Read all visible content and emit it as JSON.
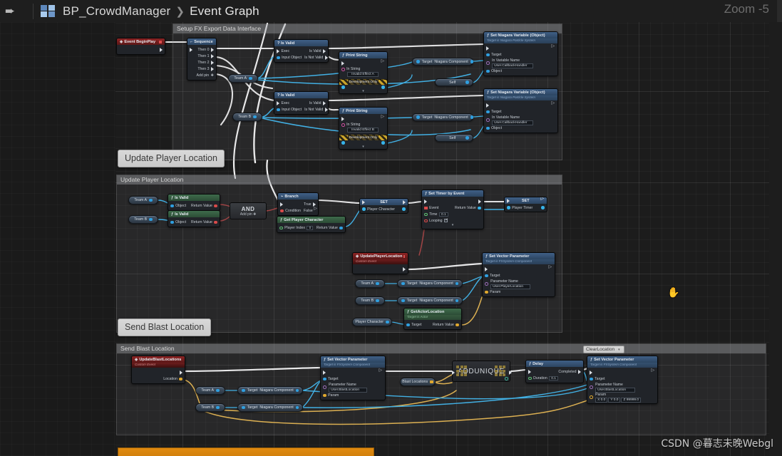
{
  "topbar": {
    "forward_icon": "forward-arrow-icon",
    "blueprint_icon": "blueprint-grid-icon",
    "blueprint_name": "BP_CrowdManager",
    "separator": "❯",
    "graph_name": "Event Graph",
    "zoom_label": "Zoom -5"
  },
  "tooltips": {
    "graph_title_overlay": "Setup FX Export Data Interface",
    "update_player_location": "Update Player Location",
    "send_blast_location": "Send Blast Location"
  },
  "watermark": "CSDN @暮志未晚Webgl",
  "comments": {
    "setup_fx": "Setup FX Export Data Interface",
    "update_player": "Update Player Location",
    "send_blast": "Send Blast Location"
  },
  "combobox": {
    "value": "ClearLocation",
    "caret": "▾"
  },
  "nodes": {
    "event_begin_play": {
      "title": "Event BeginPlay"
    },
    "sequence": {
      "title": "Sequence",
      "glyph": "Γ",
      "pins": [
        "Then 0",
        "Then 1",
        "Then 2",
        "Then 3"
      ],
      "add_pin": "Add pin"
    },
    "is_valid_a": {
      "title": "? Is Valid",
      "in_exec": "Exec",
      "in_obj": "Input Object",
      "out_valid": "Is Valid",
      "out_invalid": "Is Not Valid"
    },
    "is_valid_b": {
      "title": "? Is Valid",
      "in_exec": "Exec",
      "in_obj": "Input Object",
      "out_valid": "Is Valid",
      "out_invalid": "Is Not Valid"
    },
    "print_string_a": {
      "title": "Print String",
      "in_string_label": "In String",
      "in_string_value": "Invalid Effect A",
      "dev_only": "Development Only"
    },
    "print_string_b": {
      "title": "Print String",
      "in_string_label": "In String",
      "in_string_value": "Invalid Effect B",
      "dev_only": "Development Only"
    },
    "set_niagara_var_a": {
      "title": "Set Niagara Variable (Object)",
      "subtitle": "Target is Niagara Particle System",
      "target": "Target",
      "in_var_name_label": "In Variable Name",
      "in_var_name_value": "User.CallbackHandler",
      "object": "Object"
    },
    "set_niagara_var_b": {
      "title": "Set Niagara Variable (Object)",
      "subtitle": "Target is Niagara Particle System",
      "target": "Target",
      "in_var_name_label": "In Variable Name",
      "in_var_name_value": "User.CallbackHandler",
      "object": "Object"
    },
    "is_valid_pure_a": {
      "title": "Is Valid",
      "object": "Object",
      "return": "Return Value"
    },
    "is_valid_pure_b": {
      "title": "Is Valid",
      "object": "Object",
      "return": "Return Value"
    },
    "and_node": {
      "title": "AND",
      "add_pin": "Add pin"
    },
    "branch": {
      "title": "Branch",
      "glyph": "⎇",
      "condition": "Condition",
      "true": "True",
      "false": "False"
    },
    "get_player_character": {
      "title": "Get Player Character",
      "player_index_label": "Player Index",
      "player_index_value": "0",
      "return": "Return Value"
    },
    "set_player_character": {
      "title": "SET",
      "var": "Player Character"
    },
    "set_timer_by_event": {
      "title": "Set Timer by Event",
      "event": "Event",
      "time_label": "Time",
      "time_value": "0.1",
      "looping_label": "Looping",
      "return": "Return Value"
    },
    "set_player_timer": {
      "title": "SET",
      "var": "Player Timer"
    },
    "update_player_location_event": {
      "title": "UpdatePlayerLocation",
      "subtitle": "Custom Event"
    },
    "set_vector_param_player": {
      "title": "Set Vector Parameter",
      "subtitle": "Target is FXSystem Component",
      "target": "Target",
      "param_name_label": "Parameter Name",
      "param_name_value": "User.PlayerLocation",
      "param": "Param"
    },
    "get_actor_location": {
      "title": "GetActorLocation",
      "subtitle": "Target is Actor",
      "target": "Target",
      "return": "Return Value"
    },
    "update_blast_locations_event": {
      "title": "UpdateBlastLocations",
      "subtitle": "Custom Event",
      "location_pin": "Location"
    },
    "set_vector_param_blast": {
      "title": "Set Vector Parameter",
      "subtitle": "Target is FXSystem Component",
      "target": "Target",
      "param_name_label": "Parameter Name",
      "param_name_value": "User.BlastLocation",
      "param": "Param"
    },
    "add_unique": {
      "title": "ADDUNIQUE"
    },
    "delay": {
      "title": "Delay",
      "duration_label": "Duration",
      "duration_value": "0.1",
      "completed": "Completed"
    },
    "set_vector_param_clear": {
      "title": "Set Vector Parameter",
      "subtitle": "Target is FXSystem Component",
      "target": "Target",
      "param_name_label": "Parameter Name",
      "param_name_value": "User.BlastLocation",
      "param_label": "Param",
      "param_x_key": "X",
      "param_x": "0.0",
      "param_y_key": "Y",
      "param_y": "0.0",
      "param_z_key": "Z",
      "param_z": "99999.0"
    }
  },
  "variables": {
    "team_a": "Team A",
    "team_b": "Team B",
    "self": "Self",
    "niagara_component": "Niagara Component",
    "target": "Target",
    "player_character": "Player Character",
    "blast_locations": "Blast Locations"
  },
  "colors": {
    "exec_wire": "#e8e8e8",
    "object_wire": "#39b4ec",
    "vector_wire": "#e5b44a",
    "bool_wire": "#a23b3b",
    "accent_blue": "#3f5f86",
    "event_red": "#8e2424",
    "pure_green": "#3e6b4b",
    "orange_strip": "#e08a10"
  }
}
